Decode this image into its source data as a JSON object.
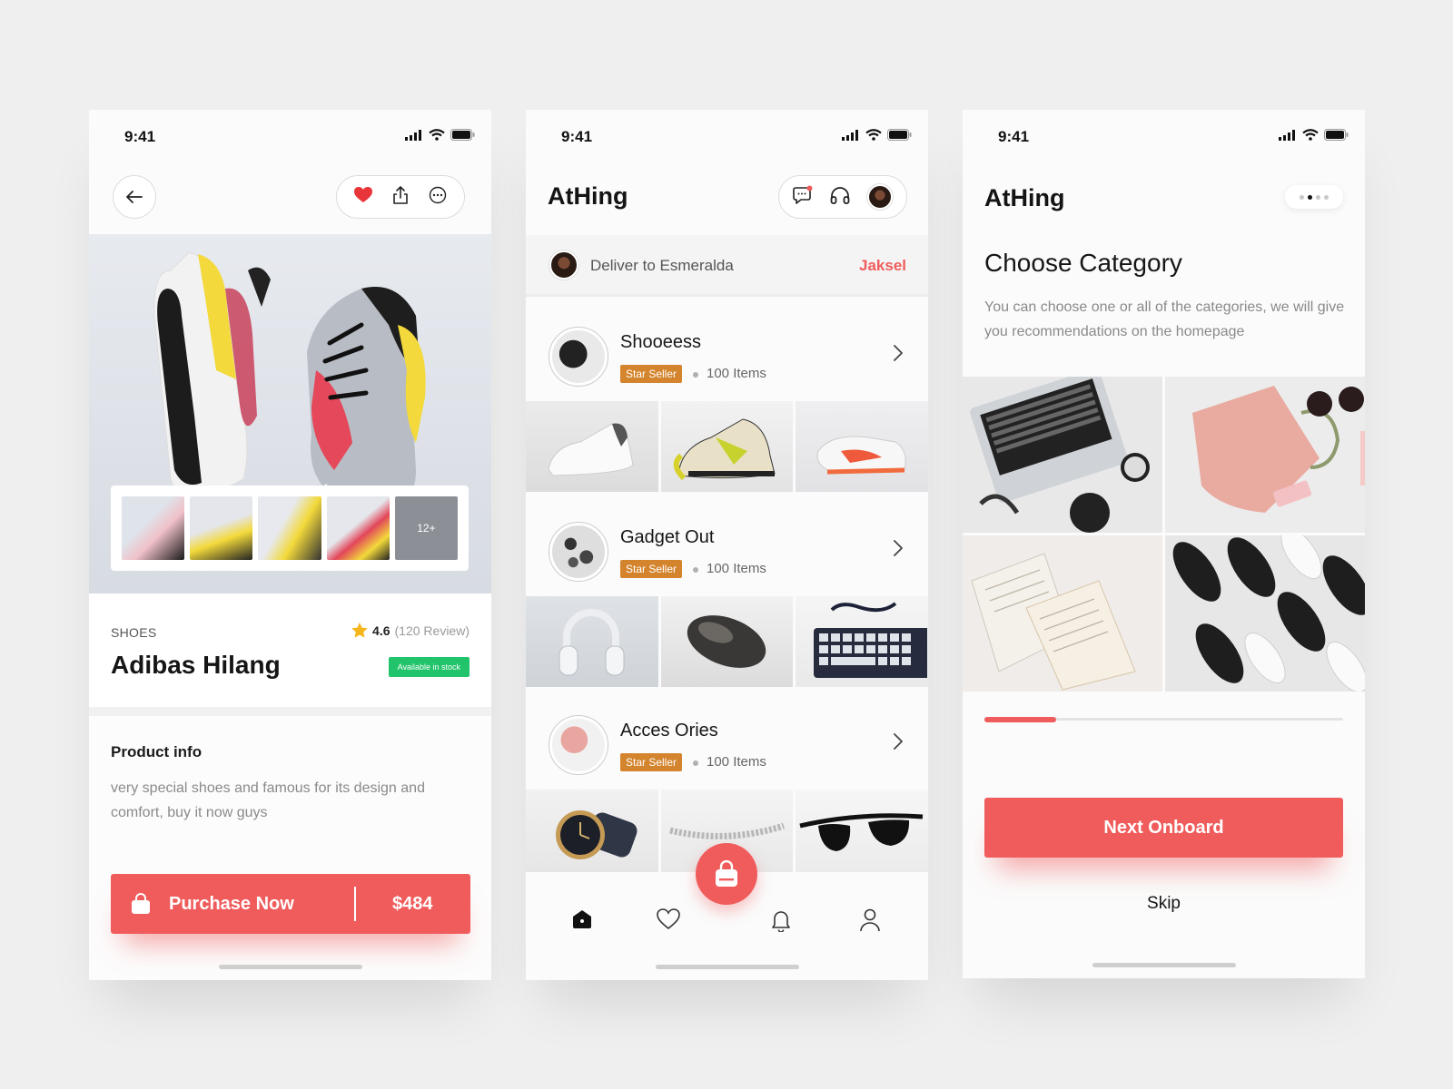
{
  "status": {
    "time": "9:41"
  },
  "product_screen": {
    "thumb_more": "12+",
    "category": "SHOES",
    "rating": "4.6",
    "reviews": "(120 Review)",
    "name": "Adibas Hilang",
    "stock": "Available in stock",
    "info_title": "Product info",
    "info_text": "very special shoes and famous for its design and comfort, buy it now guys",
    "buy_label": "Purchase Now",
    "price": "$484"
  },
  "home_screen": {
    "brand": "AtHing",
    "deliver_text": "Deliver to Esmeralda",
    "deliver_location": "Jaksel",
    "categories": [
      {
        "title": "Shooeess",
        "badge": "Star Seller",
        "count": "100 Items"
      },
      {
        "title": "Gadget Out",
        "badge": "Star Seller",
        "count": "100 Items"
      },
      {
        "title": "Acces Ories",
        "badge": "Star Seller",
        "count": "100 Items"
      }
    ]
  },
  "onboard_screen": {
    "brand": "AtHing",
    "heading": "Choose Category",
    "description": "You can choose one or all of the categories, we will give you recommendations on the homepage",
    "progress": 0.2,
    "next_label": "Next Onboard",
    "skip_label": "Skip"
  },
  "colors": {
    "accent": "#f05c5c",
    "badge": "#d4842d",
    "stock": "#21c36b"
  }
}
